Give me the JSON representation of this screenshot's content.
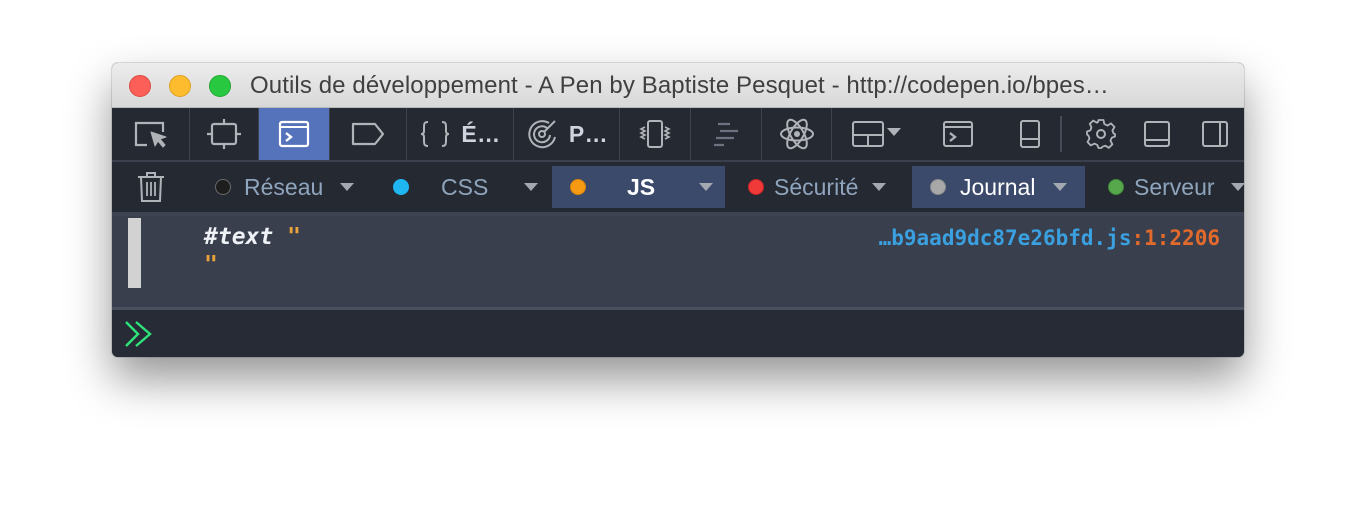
{
  "window": {
    "title": "Outils de développement - A Pen by Baptiste Pesquet - http://codepen.io/bpes…",
    "buttons": [
      "close",
      "minimize",
      "maximize"
    ]
  },
  "toolbar": {
    "tools": [
      {
        "id": "picker",
        "icon": "element-picker-icon"
      },
      {
        "id": "inspector",
        "icon": "inspector-icon"
      },
      {
        "id": "console",
        "icon": "console-icon",
        "active": true
      },
      {
        "id": "debugger",
        "icon": "debugger-icon"
      },
      {
        "id": "style-editor",
        "icon": "braces-icon",
        "label": "É…"
      },
      {
        "id": "performance",
        "icon": "performance-icon",
        "label": "P…"
      },
      {
        "id": "responsive",
        "icon": "responsive-design-icon"
      },
      {
        "id": "waterfall",
        "icon": "waterfall-icon"
      },
      {
        "id": "react",
        "icon": "react-icon"
      },
      {
        "id": "layout",
        "icon": "layout-dropdown-icon"
      },
      {
        "id": "split-console",
        "icon": "split-console-icon"
      },
      {
        "id": "dock-mobile",
        "icon": "dock-device-icon"
      },
      {
        "id": "settings",
        "icon": "gear-icon"
      },
      {
        "id": "dock-bottom",
        "icon": "dock-bottom-icon"
      },
      {
        "id": "dock-side",
        "icon": "dock-side-icon"
      }
    ]
  },
  "filters": {
    "clear_icon": "trash-icon",
    "items": [
      {
        "label": "Réseau",
        "color": "#1e1e1e",
        "active": false
      },
      {
        "label": "CSS",
        "color": "#1fb6f1",
        "active": false
      },
      {
        "label": "JS",
        "color": "#f59a12",
        "active": true
      },
      {
        "label": "Sécurité",
        "color": "#f03a3a",
        "active": false
      },
      {
        "label": "Journal",
        "color": "#a8a8a8",
        "active": true
      },
      {
        "label": "Serveur",
        "color": "#57a84c",
        "active": false
      }
    ]
  },
  "console": {
    "messages": [
      {
        "node": "#text",
        "quote_open": "\"",
        "quote_close": "\"",
        "file": "…b9aad9dc87e26bfd.js",
        "line": ":1:2206"
      }
    ],
    "input_value": "",
    "prompt_icon": "chevrons-right-icon",
    "accent": "#2ee47a"
  }
}
